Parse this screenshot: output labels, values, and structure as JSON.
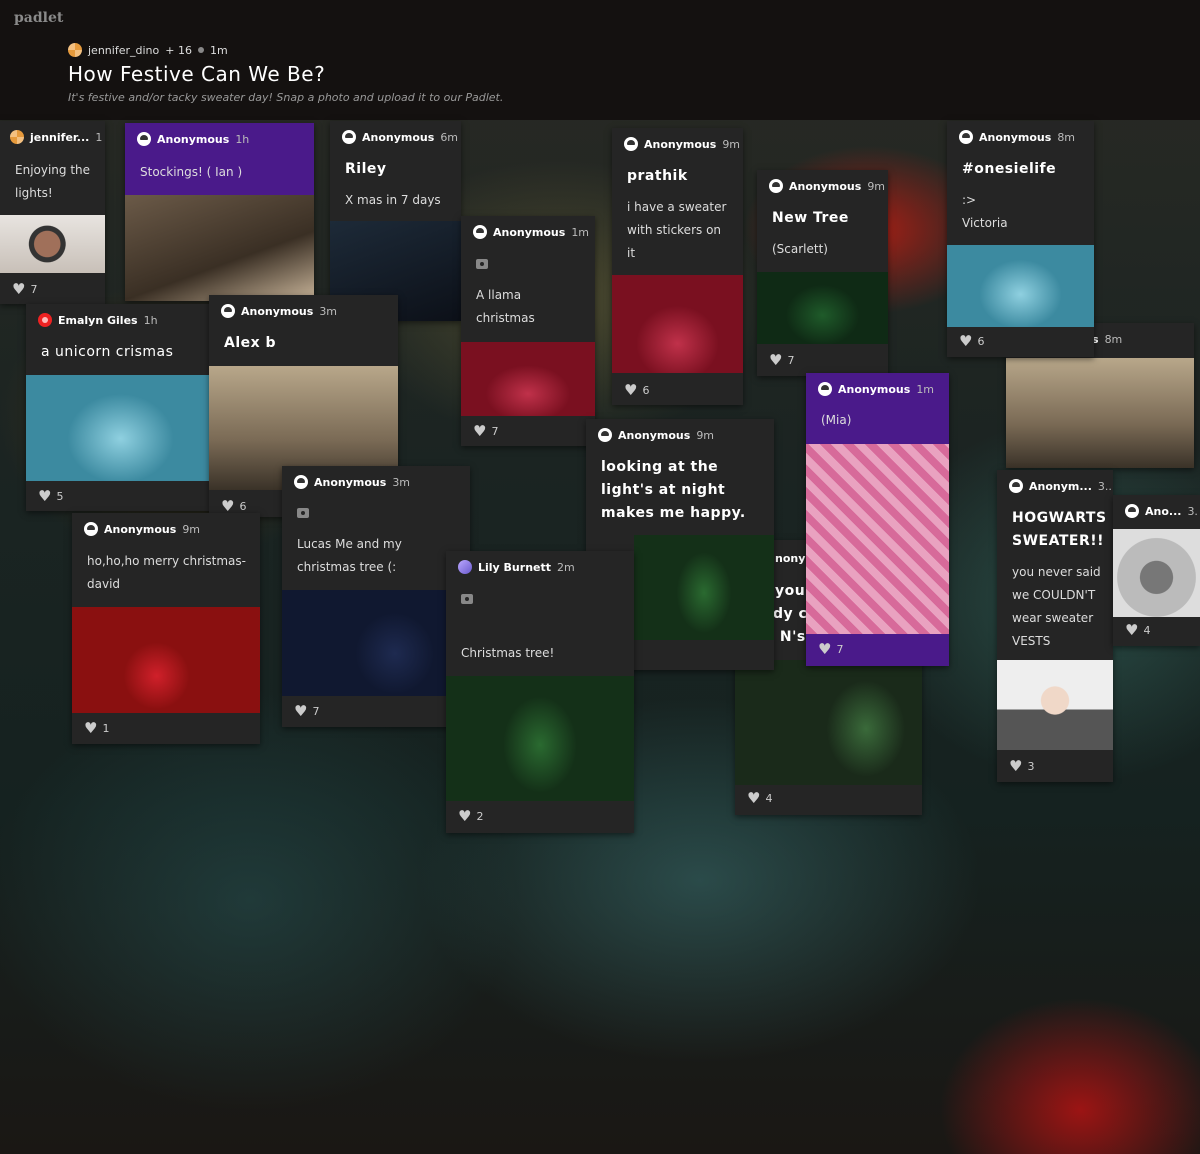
{
  "header": {
    "brand": "padlet",
    "owner": "jennifer_dino",
    "contributors": "+ 16",
    "time": "1m",
    "title": "How Festive Can We Be?",
    "subtitle": "It's festive and/or tacky sweater day! Snap a photo and upload it to our Padlet."
  },
  "cards": {
    "c1": {
      "author": "jennifer...",
      "time": "1",
      "text": "Enjoying the lights!",
      "likes": "7"
    },
    "c2": {
      "author": "Anonymous",
      "time": "1h",
      "text": "Stockings! ( Ian )"
    },
    "c3": {
      "author": "Anonymous",
      "time": "6m",
      "heading": "Riley",
      "text": "X mas in 7 days"
    },
    "c4": {
      "author": "Anonymous",
      "time": "1m",
      "text": "A llama christmas",
      "likes": "7"
    },
    "c5": {
      "author": "Anonymous",
      "time": "9m",
      "heading": "prathik",
      "text": "i have a sweater with stickers on it",
      "likes": "6"
    },
    "c6": {
      "author": "Anonymous",
      "time": "9m",
      "heading": "New Tree",
      "text": "(Scarlett)",
      "likes": "7"
    },
    "c7": {
      "author": "Anonymous",
      "time": "8m",
      "heading": "#onesielife",
      "text": ":> Victoria",
      "likes": "6"
    },
    "c8": {
      "author": "Emalyn Giles",
      "time": "1h",
      "heading": "a unicorn crismas",
      "likes": "5"
    },
    "c9": {
      "author": "Anonymous",
      "time": "3m",
      "heading": "Alex b",
      "likes": "6"
    },
    "c10": {
      "author": "Anonymous",
      "time": "1m",
      "text": "(Mia)",
      "likes": "7"
    },
    "c11": {
      "time": "8m"
    },
    "c12": {
      "author": "Anonymous",
      "time": "9m",
      "heading": "looking at the light's at night makes me happy."
    },
    "c13": {
      "author": "Anonymous",
      "time": "3m",
      "text": "Lucas Me and my christmas tree (:",
      "likes": "7"
    },
    "c14": {
      "author": "Anonymous",
      "time": "9m",
      "text": "ho,ho,ho merry christmas- david",
      "likes": "1"
    },
    "c15": {
      "author": "Lily Burnett",
      "time": "2m",
      "text": "Christmas tree!",
      "likes": "2"
    },
    "c16": {
      "author": "Anonym...",
      "time": "3...",
      "heading": "HOGWARTS SWEATER!!",
      "text": "you never said we COULDN'T wear sweater VESTS",
      "likes": "3"
    },
    "c17": {
      "author": "Ano...",
      "time": "3.",
      "likes": "4"
    },
    "c18": {
      "author": "nonym",
      "lines": [
        "you",
        "dy c",
        "x N's"
      ],
      "likes": "4"
    }
  },
  "colors": {
    "purple_card": "#4a1a8a",
    "card": "#252525",
    "header": "#141110"
  }
}
